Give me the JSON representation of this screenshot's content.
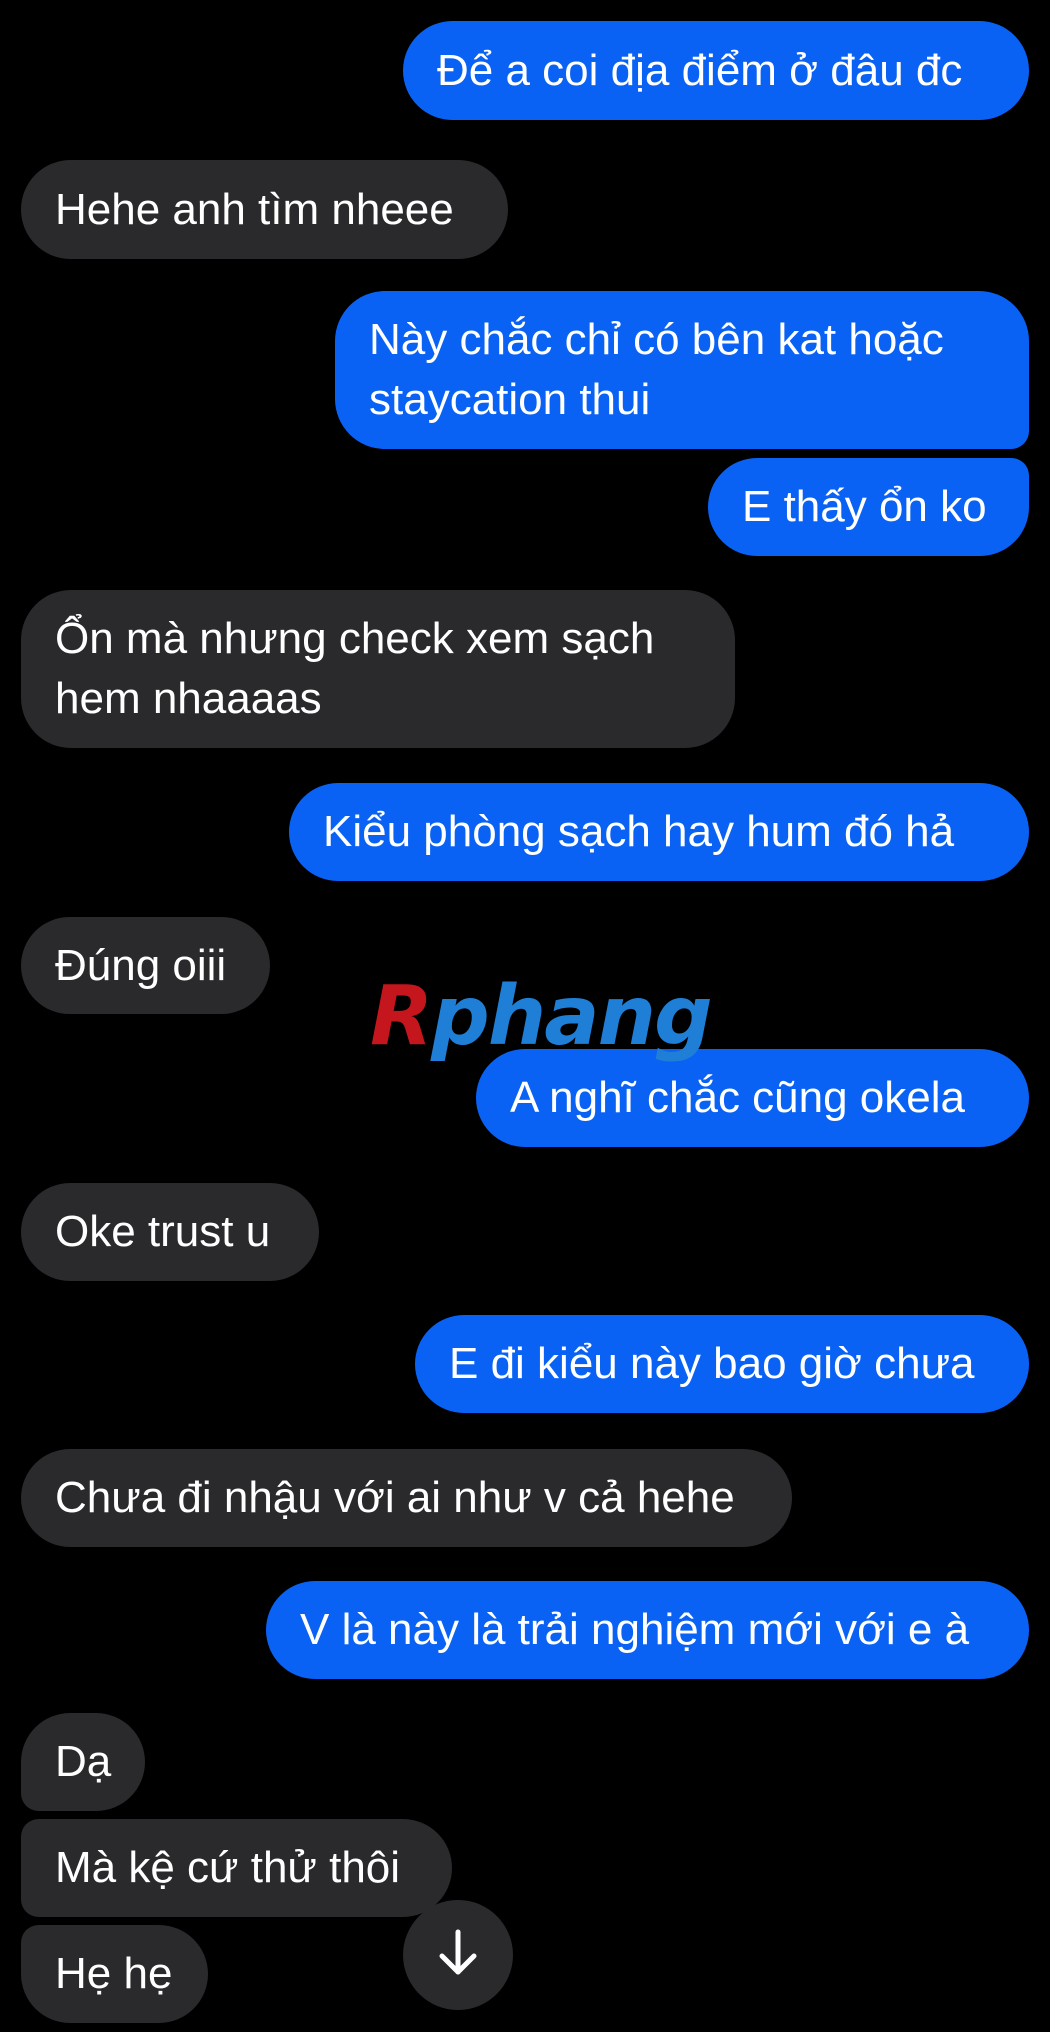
{
  "watermark": {
    "first_letter": "R",
    "rest": "phang"
  },
  "messages": [
    {
      "side": "out",
      "text": "Để a coi địa điểm ở đâu đc"
    },
    {
      "side": "in",
      "text": "Hehe anh tìm nheee"
    },
    {
      "side": "out",
      "text": "Này chắc chỉ có bên kat hoặc staycation thui"
    },
    {
      "side": "out",
      "text": "E thấy ổn ko"
    },
    {
      "side": "in",
      "text": "Ổn mà nhưng check xem sạch hem nhaaaas"
    },
    {
      "side": "out",
      "text": "Kiểu phòng sạch hay hum đó hả"
    },
    {
      "side": "in",
      "text": "Đúng oiii"
    },
    {
      "side": "out",
      "text": "A nghĩ chắc cũng okela"
    },
    {
      "side": "in",
      "text": "Oke trust u"
    },
    {
      "side": "out",
      "text": "E đi kiểu này bao giờ chưa"
    },
    {
      "side": "in",
      "text": "Chưa đi nhậu với ai như v cả hehe"
    },
    {
      "side": "out",
      "text": "V là này là trải nghiệm mới với e à"
    },
    {
      "side": "in",
      "text": "Dạ"
    },
    {
      "side": "in",
      "text": "Mà kệ cứ thử thôi"
    },
    {
      "side": "in",
      "text": "Hẹ hẹ"
    }
  ],
  "scroll_button": {
    "icon": "arrow-down-icon"
  }
}
